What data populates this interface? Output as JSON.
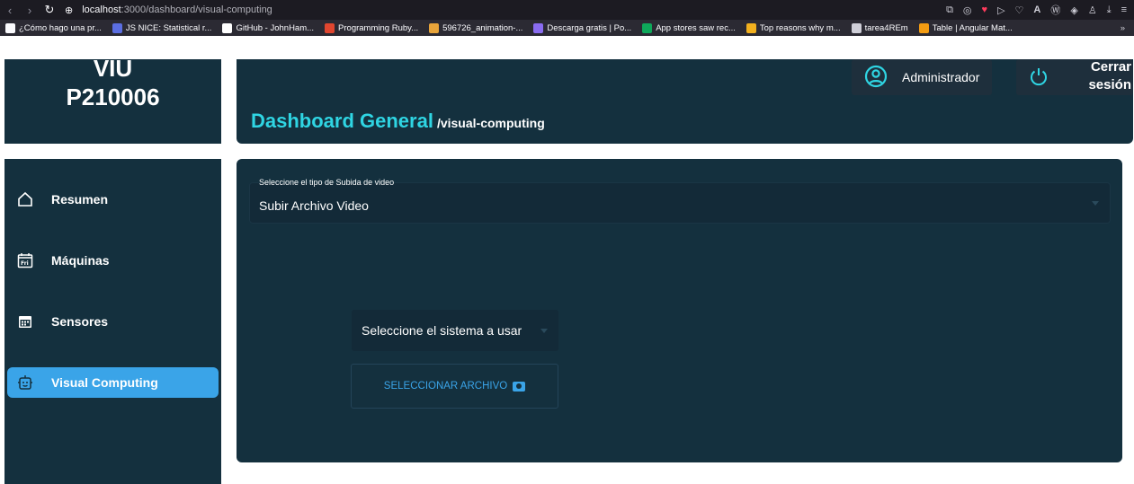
{
  "browser": {
    "url_host": "localhost",
    "url_rest": ":3000/dashboard/visual-computing",
    "bookmarks": [
      {
        "label": "¿Cómo hago una pr...",
        "color": "#fbfbfe"
      },
      {
        "label": "JS NICE: Statistical r...",
        "color": "#5b6ee1"
      },
      {
        "label": "GitHub - JohnHam...",
        "color": "#ffffff"
      },
      {
        "label": "Programming Ruby...",
        "color": "#e0462f"
      },
      {
        "label": "596726_animation-...",
        "color": "#e8a43a"
      },
      {
        "label": "Descarga gratis | Po...",
        "color": "#8a6cf0"
      },
      {
        "label": "App stores saw rec...",
        "color": "#0ea85a"
      },
      {
        "label": "Top reasons why m...",
        "color": "#f2b01e"
      },
      {
        "label": "tarea4REm",
        "color": "#cfcfd8"
      },
      {
        "label": "Table | Angular Mat...",
        "color": "#f39c12"
      }
    ],
    "bookmarks_more": "»"
  },
  "brand": {
    "line1": "VIU",
    "line2": "P210006"
  },
  "header": {
    "title": "Dashboard General",
    "subtitle": "/visual-computing",
    "admin_label": "Administrador",
    "logout_line1": "Cerrar",
    "logout_line2": "sesión"
  },
  "sidebar": {
    "items": [
      {
        "label": "Resumen",
        "icon": "home-icon",
        "active": false
      },
      {
        "label": "Máquinas",
        "icon": "calendar-fri-icon",
        "active": false
      },
      {
        "label": "Sensores",
        "icon": "calendar-grid-icon",
        "active": false
      },
      {
        "label": "Visual Computing",
        "icon": "robot-icon",
        "active": true
      }
    ]
  },
  "main": {
    "upload_type_label": "Seleccione el tipo de Subida de video",
    "upload_type_value": "Subir Archivo Video",
    "system_select_placeholder": "Seleccione el sistema a usar",
    "select_file_button": "SELECCIONAR ARCHIVO"
  },
  "colors": {
    "panel": "#14303e",
    "accent": "#3aa4e8",
    "title": "#2fd5e3"
  }
}
